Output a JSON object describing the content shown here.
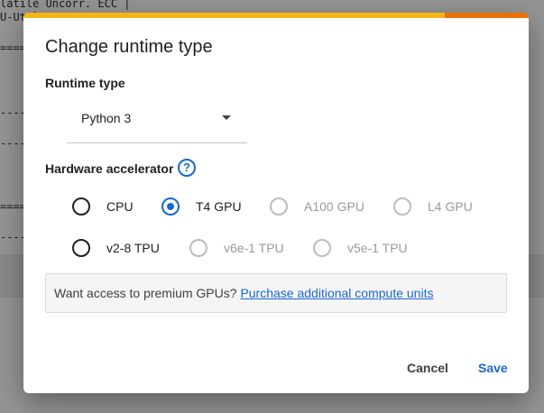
{
  "background": {
    "terminal_lines": [
      "latile Uncorr. ECC |",
      "U-Util"
    ]
  },
  "dialog": {
    "title": "Change runtime type",
    "runtime_type_label": "Runtime type",
    "runtime_type_value": "Python 3",
    "hardware_accelerator_label": "Hardware accelerator",
    "help_glyph": "?",
    "accelerators": [
      {
        "label": "CPU",
        "checked": false,
        "disabled": false
      },
      {
        "label": "T4 GPU",
        "checked": true,
        "disabled": false
      },
      {
        "label": "A100 GPU",
        "checked": false,
        "disabled": true
      },
      {
        "label": "L4 GPU",
        "checked": false,
        "disabled": true
      },
      {
        "label": "v2-8 TPU",
        "checked": false,
        "disabled": false
      },
      {
        "label": "v6e-1 TPU",
        "checked": false,
        "disabled": true
      },
      {
        "label": "v5e-1 TPU",
        "checked": false,
        "disabled": true
      }
    ],
    "banner_text": "Want access to premium GPUs?",
    "banner_link": "Purchase additional compute units",
    "cancel_label": "Cancel",
    "save_label": "Save"
  },
  "colors": {
    "accent": "#1967d2",
    "progress_yellow": "#f3b619",
    "progress_orange": "#e8710a"
  }
}
